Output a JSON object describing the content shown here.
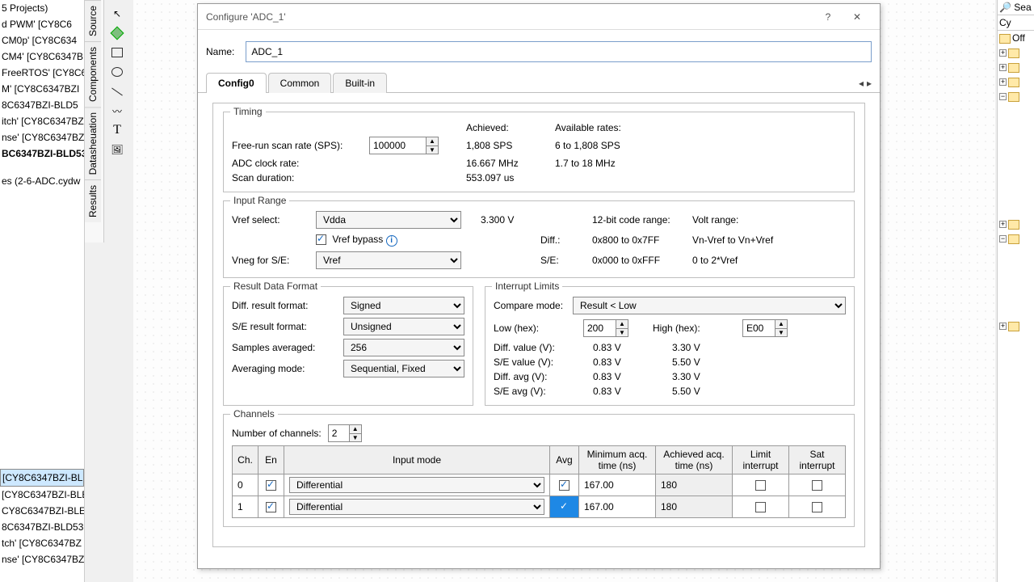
{
  "left_tree": {
    "top": [
      "5 Projects)",
      "d PWM' [CY8C6",
      "CM0p' [CY8C634",
      "CM4' [CY8C6347B",
      "FreeRTOS' [CY8C6",
      "M' [CY8C6347BZI",
      "8C6347BZI-BLD5",
      "itch' [CY8C6347BZ",
      "nse' [CY8C6347BZ"
    ],
    "bold": "BC6347BZI-BLD53",
    "secondary": "es (2-6-ADC.cydw",
    "bottom": [
      "[CY8C6347BZI-BL",
      "[CY8C6347BZI-BLE",
      "CY8C6347BZI-BLE",
      "8C6347BZI-BLD53",
      "tch' [CY8C6347BZ",
      "nse' [CY8C6347BZ]"
    ]
  },
  "side_tabs": [
    "Source",
    "Components",
    "Datasheuation",
    "Results"
  ],
  "right_panel": {
    "header_items": [
      "Sea",
      "Cy",
      "Off"
    ]
  },
  "dialog": {
    "title": "Configure 'ADC_1'",
    "help": "?",
    "close": "✕",
    "name_label": "Name:",
    "name_value": "ADC_1",
    "tabs": [
      "Config0",
      "Common",
      "Built-in"
    ],
    "nav_prev": "◂",
    "nav_next": "▸",
    "timing": {
      "title": "Timing",
      "free_run_label": "Free-run scan rate (SPS):",
      "free_run_value": "100000",
      "adc_clock_label": "ADC clock rate:",
      "scan_dur_label": "Scan duration:",
      "achieved_hdr": "Achieved:",
      "available_hdr": "Available rates:",
      "achieved_sps": "1,808 SPS",
      "available_sps": "6 to 1,808 SPS",
      "achieved_clk": "16.667 MHz",
      "available_clk": "1.7 to 18 MHz",
      "scan_dur_val": "553.097 us"
    },
    "input_range": {
      "title": "Input Range",
      "vref_label": "Vref select:",
      "vref_value": "Vdda",
      "vref_voltage": "3.300 V",
      "vref_bypass_label": "Vref bypass",
      "vneg_label": "Vneg for S/E:",
      "vneg_value": "Vref",
      "code_range_label": "12-bit code range:",
      "volt_range_label": "Volt range:",
      "diff_label": "Diff.:",
      "diff_code": "0x800 to 0x7FF",
      "diff_volt": "Vn-Vref to Vn+Vref",
      "se_label": "S/E:",
      "se_code": "0x000 to 0xFFF",
      "se_volt": "0 to 2*Vref"
    },
    "result_fmt": {
      "title": "Result Data Format",
      "diff_fmt_label": "Diff. result format:",
      "diff_fmt_value": "Signed",
      "se_fmt_label": "S/E result format:",
      "se_fmt_value": "Unsigned",
      "samples_label": "Samples averaged:",
      "samples_value": "256",
      "avg_mode_label": "Averaging mode:",
      "avg_mode_value": "Sequential, Fixed"
    },
    "intr": {
      "title": "Interrupt Limits",
      "cmp_label": "Compare mode:",
      "cmp_value": "Result < Low",
      "low_label": "Low (hex):",
      "low_value": "200",
      "high_label": "High (hex):",
      "high_value": "E00",
      "rows": {
        "diff_val_l": "Diff. value (V):",
        "diff_val_low": "0.83 V",
        "diff_val_high": "3.30 V",
        "se_val_l": "S/E value (V):",
        "se_val_low": "0.83 V",
        "se_val_high": "5.50 V",
        "diff_avg_l": "Diff. avg (V):",
        "diff_avg_low": "0.83 V",
        "diff_avg_high": "3.30 V",
        "se_avg_l": "S/E avg (V):",
        "se_avg_low": "0.83 V",
        "se_avg_high": "5.50 V"
      }
    },
    "channels": {
      "title": "Channels",
      "num_label": "Number of channels:",
      "num_value": "2",
      "headers": {
        "ch": "Ch.",
        "en": "En",
        "mode": "Input mode",
        "avg": "Avg",
        "min_acq1": "Minimum acq.",
        "min_acq2": "time (ns)",
        "ach_acq1": "Achieved acq.",
        "ach_acq2": "time (ns)",
        "limit1": "Limit",
        "limit2": "interrupt",
        "sat1": "Sat",
        "sat2": "interrupt"
      },
      "rows": [
        {
          "ch": "0",
          "mode": "Differential",
          "min": "167.00",
          "ach": "180"
        },
        {
          "ch": "1",
          "mode": "Differential",
          "min": "167.00",
          "ach": "180"
        }
      ]
    }
  }
}
